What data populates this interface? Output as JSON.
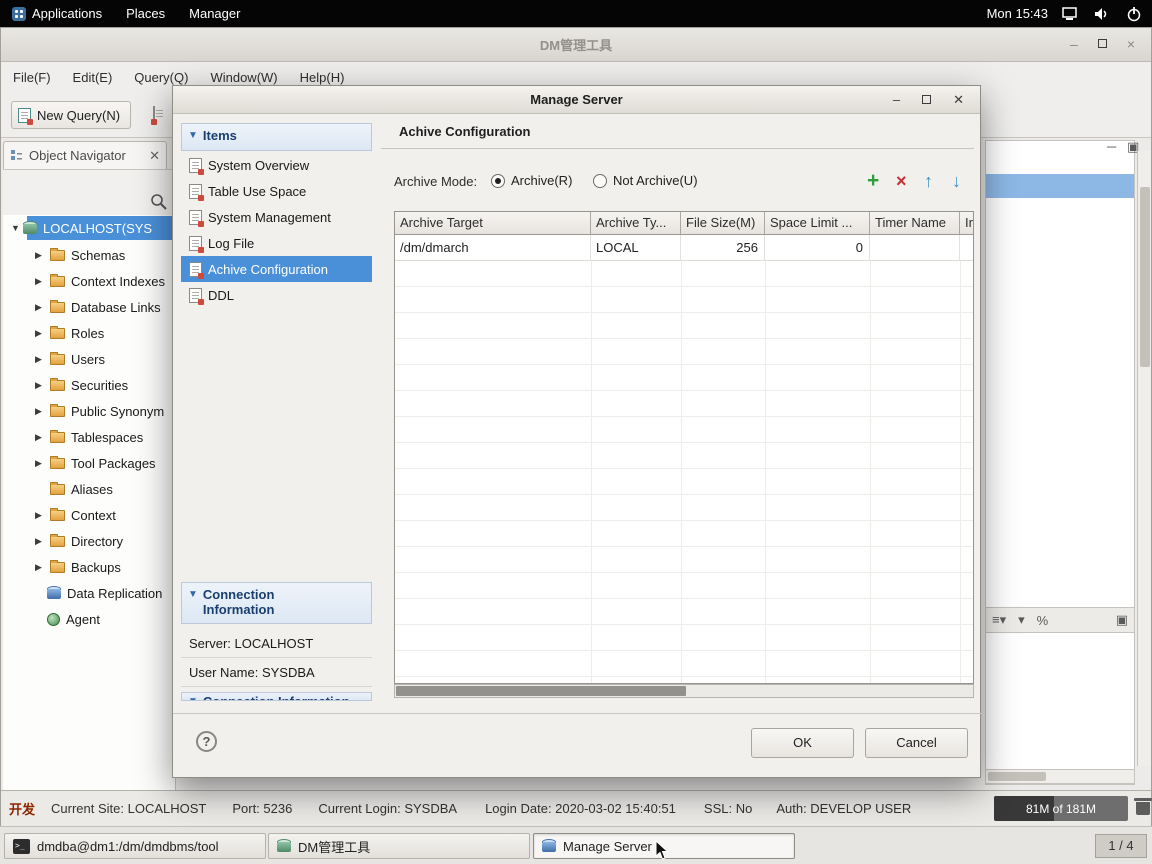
{
  "topbar": {
    "applications": "Applications",
    "places": "Places",
    "manager": "Manager",
    "clock": "Mon 15:43"
  },
  "main_window": {
    "title": "DM管理工具",
    "menubar": {
      "file": "File(F)",
      "edit": "Edit(E)",
      "query": "Query(Q)",
      "window": "Window(W)",
      "help": "Help(H)"
    },
    "toolbar": {
      "new_query": "New Query(N)"
    },
    "navigator": {
      "tab": "Object Navigator",
      "root": "LOCALHOST(SYS",
      "items": [
        {
          "label": "Schemas"
        },
        {
          "label": "Context Indexes"
        },
        {
          "label": "Database Links"
        },
        {
          "label": "Roles"
        },
        {
          "label": "Users"
        },
        {
          "label": "Securities"
        },
        {
          "label": "Public Synonym"
        },
        {
          "label": "Tablespaces"
        },
        {
          "label": "Tool Packages"
        },
        {
          "label": "Aliases"
        },
        {
          "label": "Context"
        },
        {
          "label": "Directory"
        },
        {
          "label": "Backups"
        },
        {
          "label": "Data Replication"
        },
        {
          "label": "Agent"
        }
      ]
    },
    "statusbar": {
      "dev": "开发",
      "site": "Current Site: LOCALHOST",
      "port": "Port: 5236",
      "login": "Current Login: SYSDBA",
      "login_date": "Login Date: 2020-03-02 15:40:51",
      "ssl": "SSL: No",
      "auth": "Auth: DEVELOP USER",
      "memory": "81M of 181M"
    }
  },
  "dialog": {
    "title": "Manage Server",
    "items_header": "Items",
    "items": [
      {
        "label": "System Overview"
      },
      {
        "label": "Table Use Space"
      },
      {
        "label": "System Management"
      },
      {
        "label": "Log File"
      },
      {
        "label": "Achive Configuration"
      },
      {
        "label": "DDL"
      }
    ],
    "connection": {
      "header_line1": "Connection",
      "header_line2": "Information",
      "header_partial": "Connection Information",
      "server": "Server: LOCALHOST",
      "user": "User Name: SYSDBA"
    },
    "content": {
      "title": "Achive Configuration",
      "archive_mode_label": "Archive Mode:",
      "radio_archive": "Archive(R)",
      "radio_not_archive": "Not Archive(U)",
      "table": {
        "columns": [
          "Archive Target",
          "Archive Ty...",
          "File Size(M)",
          "Space Limit ...",
          "Timer Name",
          "In"
        ],
        "row": {
          "target": "/dm/dmarch",
          "type": "LOCAL",
          "file_size": "256",
          "space_limit": "0"
        }
      }
    },
    "ok": "OK",
    "cancel": "Cancel"
  },
  "taskbar": {
    "windows": [
      {
        "label": "dmdba@dm1:/dm/dmdbms/tool"
      },
      {
        "label": "DM管理工具"
      },
      {
        "label": "Manage Server"
      }
    ],
    "workspace": "1 / 4"
  }
}
